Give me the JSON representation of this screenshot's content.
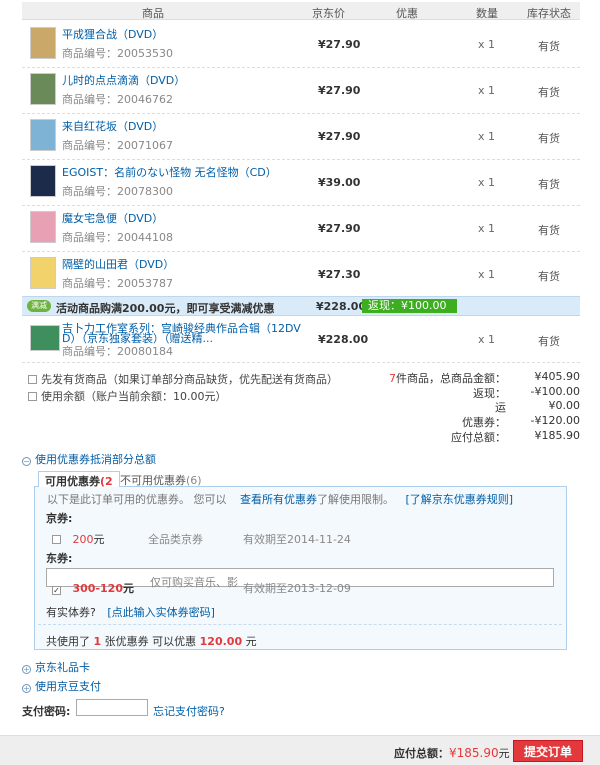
{
  "table_header": {
    "product": "商品",
    "price": "京东价",
    "discount": "优惠",
    "qty": "数量",
    "stock": "库存状态"
  },
  "items": [
    {
      "name": "平成狸合战（DVD）",
      "code": "商品编号：20053530",
      "price": "¥27.90",
      "qty": "x 1",
      "stock": "有货",
      "thumb_color": "#c9a86a"
    },
    {
      "name": "儿时的点点滴滴（DVD）",
      "code": "商品编号：20046762",
      "price": "¥27.90",
      "qty": "x 1",
      "stock": "有货",
      "thumb_color": "#6b8a5a"
    },
    {
      "name": "来自红花坂（DVD）",
      "code": "商品编号：20071067",
      "price": "¥27.90",
      "qty": "x 1",
      "stock": "有货",
      "thumb_color": "#7fb3d5"
    },
    {
      "name": "EGOIST：名前のない怪物 无名怪物（CD）",
      "code": "商品编号：20078300",
      "price": "¥39.00",
      "qty": "x 1",
      "stock": "有货",
      "thumb_color": "#1d2b4a"
    },
    {
      "name": "魔女宅急便（DVD）",
      "code": "商品编号：20044108",
      "price": "¥27.90",
      "qty": "x 1",
      "stock": "有货",
      "thumb_color": "#e8a0b4"
    },
    {
      "name": "隔壁的山田君（DVD）",
      "code": "商品编号：20053787",
      "price": "¥27.30",
      "qty": "x 1",
      "stock": "有货",
      "thumb_color": "#f2d36b"
    }
  ],
  "promo": {
    "tag": "满减",
    "text": "活动商品购满200.00元，即可享受满减优惠",
    "amount": "¥228.00",
    "rebate": "返现：¥100.00"
  },
  "bundle": {
    "name_line1": "吉卜力工作室系列：宫崎骏经典作品合辑（12DV",
    "name_line2": "D）（京东独家套装）（赠送精...",
    "code": "商品编号：20080184",
    "price": "¥228.00",
    "qty": "x 1",
    "stock": "有货",
    "thumb_color": "#3f8f5e"
  },
  "options": {
    "ship_first": "先发有货商品（如果订单部分商品缺货，优先配送有货商品）",
    "use_balance": "使用余额（账户当前余额：10.00元）"
  },
  "summary": {
    "count_num": "7",
    "count_text": "件商品，总商品金额：",
    "total": "¥405.90",
    "rebate_label": "返现：",
    "rebate": "-¥100.00",
    "shipping_label": "运",
    "shipping": "¥0.00",
    "coupon_label": "优惠券：",
    "coupon": "-¥120.00",
    "payable_label": "应付总额：",
    "payable": "¥185.90"
  },
  "coupon_section": {
    "title": "使用优惠券抵消部分总额",
    "tab_available": "可用优惠券",
    "tab_available_count": "(2",
    "tab_unavailable": "不可用优惠券",
    "tab_unavailable_count": "(6)",
    "intro": "以下是此订单可用的优惠券。 您可以",
    "view_all": "查看所有优惠券",
    "intro_tail": "了解使用限制。",
    "rules_link": "[了解京东优惠券规则]",
    "jing_label": "京券:",
    "jing_value": "200",
    "jing_unit": "元",
    "jing_scope": "全品类京券",
    "jing_expiry": "有效期至2014-11-24",
    "dong_label": "东券:",
    "dong_value": "300-120",
    "dong_unit": "元",
    "dong_scope": "仅可购买音乐、影",
    "dong_expiry": "有效期至2013-12-09",
    "physical_q": "有实体券?",
    "physical_link": "[点此输入实体券密码]",
    "used_prefix": "共使用了",
    "used_count": "1",
    "used_mid": "张优惠券    可以优惠",
    "used_amount": "120.00",
    "used_unit": "元"
  },
  "gift_card": "京东礼品卡",
  "jd_beans": "使用京豆支付",
  "pay_password": {
    "label": "支付密码:",
    "value": "",
    "forgot": "忘记支付密码?"
  },
  "footer": {
    "payable_label": "应付总额：",
    "payable": "¥185.90",
    "unit": "元",
    "submit": "提交订单"
  }
}
